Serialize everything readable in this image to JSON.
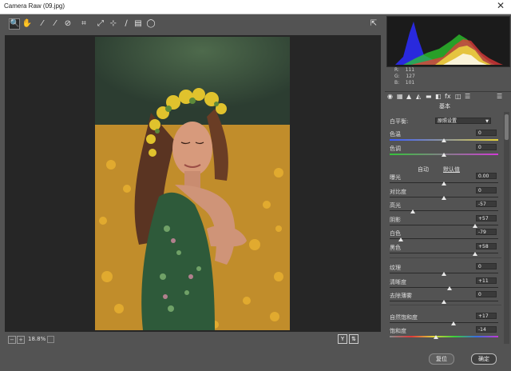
{
  "window": {
    "title": "Camera Raw (09.jpg)",
    "close": "✕"
  },
  "tools": [
    "🔍",
    "✋",
    "⁄",
    "⁄",
    "⊘",
    "⌗",
    "⤢",
    "⊹",
    "∕",
    "▤",
    "◯"
  ],
  "toolbar_right": "⇱",
  "histogram": {
    "r_label": "R:",
    "r": "111",
    "g_label": "G:",
    "g": "127",
    "b_label": "B:",
    "b": "101"
  },
  "panel_tabs": [
    "◉",
    "▦",
    "▲",
    "◭",
    "▬",
    "◧",
    "fx",
    "◫",
    "☰"
  ],
  "panel_title": "基本",
  "white_balance": {
    "label": "白平衡:",
    "value": "原照设置"
  },
  "sliders_wb": [
    {
      "label": "色温",
      "value": "0",
      "pos": 0.5
    },
    {
      "label": "色调",
      "value": "0",
      "pos": 0.5
    }
  ],
  "auto_label": "自动",
  "default_label": "默认值",
  "sliders_tone": [
    {
      "label": "曝光",
      "value": "0.00",
      "pos": 0.5
    },
    {
      "label": "对比度",
      "value": "0",
      "pos": 0.5
    },
    {
      "label": "高光",
      "value": "-57",
      "pos": 0.215
    },
    {
      "label": "阴影",
      "value": "+57",
      "pos": 0.785
    },
    {
      "label": "白色",
      "value": "-79",
      "pos": 0.105
    },
    {
      "label": "黑色",
      "value": "+58",
      "pos": 0.79
    }
  ],
  "sliders_presence": [
    {
      "label": "纹理",
      "value": "0",
      "pos": 0.5
    },
    {
      "label": "清晰度",
      "value": "+11",
      "pos": 0.555
    },
    {
      "label": "去除薄雾",
      "value": "0",
      "pos": 0.5
    }
  ],
  "sliders_color": [
    {
      "label": "自然饱和度",
      "value": "+17",
      "pos": 0.585
    },
    {
      "label": "饱和度",
      "value": "-14",
      "pos": 0.43
    }
  ],
  "zoom": "18.8%",
  "y_button": "Y",
  "footer": {
    "reset": "复位",
    "ok": "确定"
  },
  "colors": {
    "accent": "#535353",
    "preview_bg": "#262626"
  }
}
